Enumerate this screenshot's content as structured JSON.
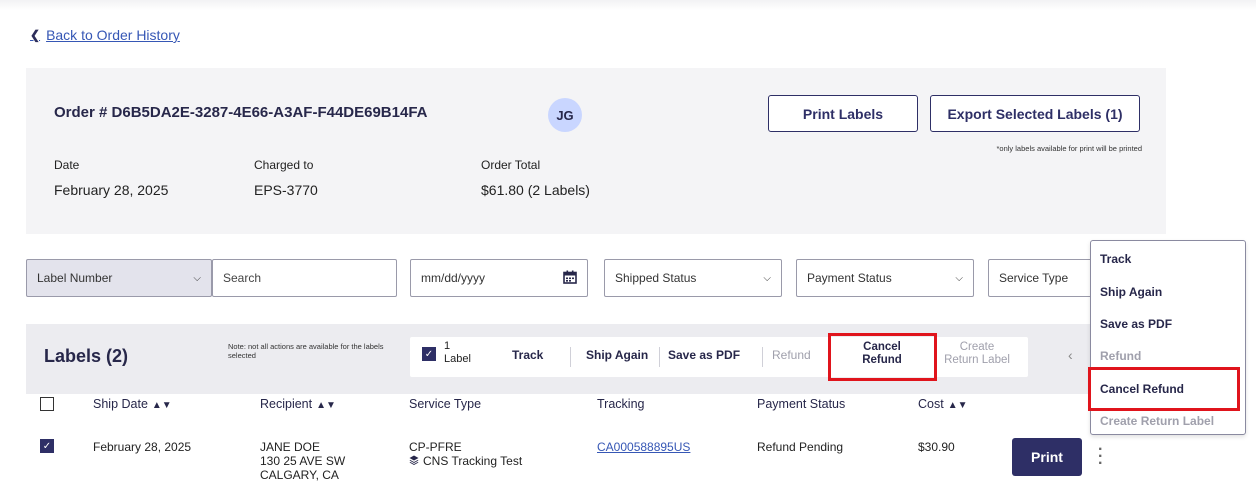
{
  "nav": {
    "back_label": "Back to Order History"
  },
  "order": {
    "number": "Order # D6B5DA2E-3287-4E66-A3AF-F44DE69B14FA",
    "avatar_initials": "JG",
    "print_labels": "Print Labels",
    "export_labels": "Export Selected Labels (1)",
    "print_note": "*only labels available for print will be printed",
    "date_label": "Date",
    "date_value": "February 28, 2025",
    "charged_label": "Charged to",
    "charged_value": "EPS-3770",
    "total_label": "Order Total",
    "total_value": "$61.80 (2 Labels)"
  },
  "filters": {
    "label_number": "Label Number",
    "search_placeholder": "Search",
    "date_placeholder": "mm/dd/yyyy",
    "shipped_status": "Shipped Status",
    "payment_status": "Payment Status",
    "service_type": "Service Type"
  },
  "labels": {
    "title": "Labels (2)",
    "note": "Note: not all actions are available for the labels selected",
    "selected_count": "1",
    "selected_unit": "Label",
    "actions": {
      "track": "Track",
      "ship_again": "Ship Again",
      "save_pdf": "Save as PDF",
      "refund": "Refund",
      "cancel_refund_1": "Cancel",
      "cancel_refund_2": "Refund",
      "create_return_1": "Create",
      "create_return_2": "Return Label"
    }
  },
  "table": {
    "headers": {
      "ship_date": "Ship Date",
      "recipient": "Recipient",
      "service_type": "Service Type",
      "tracking": "Tracking",
      "payment_status": "Payment Status",
      "cost": "Cost"
    },
    "rows": [
      {
        "ship_date": "February 28, 2025",
        "recipient_name": "JANE DOE",
        "recipient_addr1": "130 25 AVE SW",
        "recipient_addr2": "CALGARY, CA",
        "service": "CP-PFRE",
        "service_sub": "CNS Tracking Test",
        "tracking": "CA000588895US",
        "payment_status": "Refund Pending",
        "cost": "$30.90",
        "print": "Print"
      }
    ]
  },
  "menu": {
    "items": [
      "Track",
      "Ship Again",
      "Save as PDF",
      "Refund",
      "Cancel Refund",
      "Create Return Label"
    ]
  },
  "colors": {
    "primary": "#2e2f66",
    "highlight": "#e0141c",
    "link": "#3657b5"
  }
}
